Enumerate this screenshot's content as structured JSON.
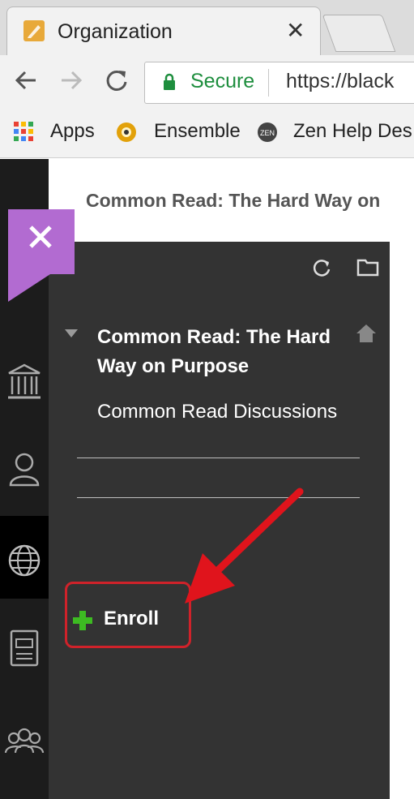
{
  "browser": {
    "tab_title": "Organization",
    "tab_close": "✕",
    "secure_label": "Secure",
    "url": "https://black",
    "bookmarks": {
      "apps": "Apps",
      "ensemble": "Ensemble",
      "zen": "Zen Help Des"
    }
  },
  "page": {
    "header_title": "Common Read: The Hard Way on"
  },
  "drawer": {
    "course_title": "Common Read: The Hard Way on Purpose",
    "links": [
      "Common Read Discussions"
    ],
    "enroll_label": "Enroll"
  },
  "colors": {
    "accent": "#b26bd1",
    "drawer_bg": "#333333",
    "rail_bg": "#1c1c1c",
    "highlight": "#d0222a",
    "enroll_plus": "#3dbb22",
    "secure_green": "#1e8e3e"
  },
  "icons": {
    "rail": [
      "institution-icon",
      "profile-icon",
      "globe-icon",
      "courses-icon",
      "groups-icon"
    ],
    "drawer_tools": [
      "refresh-icon",
      "folder-icon"
    ]
  }
}
